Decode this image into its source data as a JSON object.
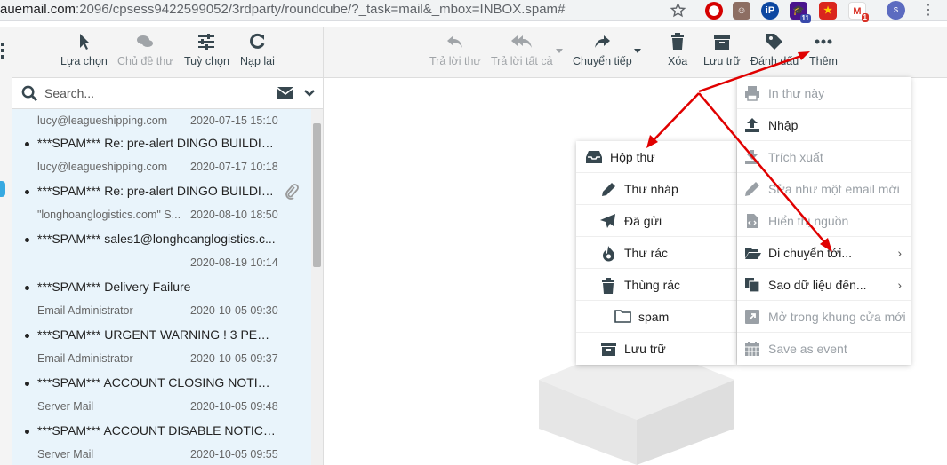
{
  "browser": {
    "url_host": "auemail.com",
    "url_rest": ":2096/cpsess9422599052/3rdparty/roundcube/?_task=mail&_mbox=INBOX.spam#",
    "ext_badge_1": "11",
    "ext_badge_2": "1",
    "profile_initial": "s"
  },
  "list_toolbar": {
    "select": "Lựa chọn",
    "threads": "Chủ đề thư",
    "options": "Tuỳ chọn",
    "refresh": "Nạp lại"
  },
  "main_toolbar": {
    "reply": "Trả lời thư",
    "reply_all": "Trả lời tất cả",
    "forward": "Chuyển tiếp",
    "delete": "Xóa",
    "archive": "Lưu trữ",
    "flag": "Đánh dấu",
    "more": "Thêm"
  },
  "search": {
    "placeholder": "Search..."
  },
  "messages": [
    {
      "from": "lucy@leagueshipping.com",
      "date": "2020-07-15 15:10",
      "subject": ""
    },
    {
      "from": "lucy@leagueshipping.com",
      "date": "2020-07-17 10:18",
      "subject": "***SPAM*** Re: pre-alert DINGO BUILDIN..."
    },
    {
      "from": "\"longhoanglogistics.com\" S...",
      "date": "2020-08-10 18:50",
      "subject": "***SPAM*** Re: pre-alert DINGO BUILDIN..."
    },
    {
      "from": "",
      "date": "2020-08-19 10:14",
      "subject": "***SPAM*** sales1@longhoanglogistics.c..."
    },
    {
      "from": "Email Administrator",
      "date": "2020-10-05 09:30",
      "subject": "***SPAM*** Delivery Failure"
    },
    {
      "from": "Email Administrator",
      "date": "2020-10-05 09:37",
      "subject": "***SPAM*** URGENT WARNING ! 3 PENDI..."
    },
    {
      "from": "Server Mail",
      "date": "2020-10-05 09:48",
      "subject": "***SPAM*** ACCOUNT CLOSING NOTICE ..."
    },
    {
      "from": "Server Mail",
      "date": "2020-10-05 09:55",
      "subject": "***SPAM*** ACCOUNT DISABLE NOTICE !..."
    }
  ],
  "folders": {
    "inbox": "Hộp thư",
    "drafts": "Thư nháp",
    "sent": "Đã gửi",
    "junk": "Thư rác",
    "trash": "Thùng rác",
    "spam": "spam",
    "archive": "Lưu trữ"
  },
  "more_menu": {
    "print": "In thư này",
    "import": "Nhập",
    "export": "Trích xuất",
    "edit_as_new": "Sửa như một email mới",
    "show_source": "Hiển thị nguồn",
    "move_to": "Di chuyển tới...",
    "copy_to": "Sao dữ liệu đến...",
    "open_new_window": "Mở trong khung cửa mới",
    "save_as_event": "Save as event"
  },
  "colors": {
    "annotation": "#e00000",
    "toolbar_text": "#37474f",
    "disabled_text": "#a0a4a8",
    "list_bg": "#e9f4fb"
  }
}
